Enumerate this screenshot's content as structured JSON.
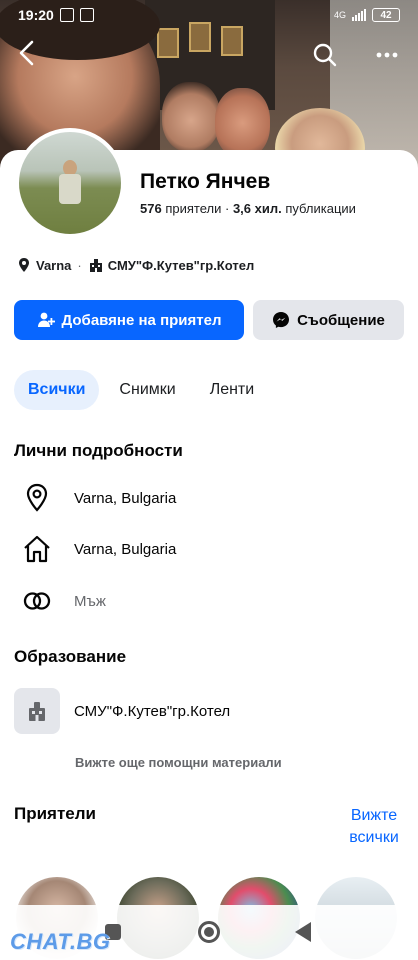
{
  "status_bar": {
    "time": "19:20",
    "network": "4G",
    "battery": "42"
  },
  "profile": {
    "name": "Петко Янчев",
    "friends_count": "576",
    "friends_label": "приятели",
    "separator": "·",
    "posts_count": "3,6 хил.",
    "posts_label": "публикации",
    "location": "Varna",
    "meta_separator": "·",
    "school": "СМУ\"Ф.Кутев\"гр.Котел"
  },
  "actions": {
    "add_friend": "Добавяне на приятел",
    "message": "Съобщение"
  },
  "tabs": [
    {
      "label": "Всички",
      "active": true
    },
    {
      "label": "Снимки",
      "active": false
    },
    {
      "label": "Ленти",
      "active": false
    }
  ],
  "details": {
    "title": "Лични подробности",
    "items": [
      {
        "icon": "location-pin-icon",
        "text": "Varna, Bulgaria"
      },
      {
        "icon": "home-icon",
        "text": "Varna, Bulgaria"
      },
      {
        "icon": "gender-rings-icon",
        "text": "Мъж"
      }
    ]
  },
  "education": {
    "title": "Образование",
    "school": "СМУ\"Ф.Кутев\"гр.Котел",
    "see_more": "Вижте още помощни материали"
  },
  "friends": {
    "title": "Приятели",
    "see_all": "Вижте всички"
  },
  "watermark": "CHAT.BG",
  "colors": {
    "primary": "#0866ff",
    "secondary_button": "#e4e6eb",
    "active_tab_bg": "#e7f0fd",
    "muted_text": "#65676b"
  }
}
